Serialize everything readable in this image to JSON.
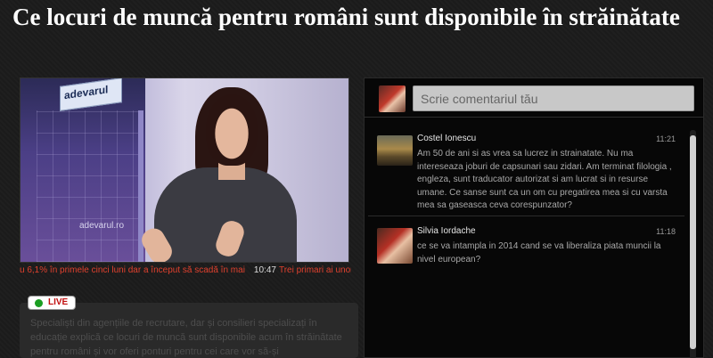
{
  "article": {
    "title": "Ce locuri de muncă pentru români sunt disponibile în străinătate",
    "description": "Specialiști din agențiile de recrutare, dar și consilieri specializați în educație explică ce locuri de muncă sunt disponibile acum în străinătate pentru români și vor oferi ponturi pentru cei care vor să-și îmbunătățească șansele în ochii"
  },
  "video": {
    "logo_top": "adevarul",
    "logo_bottom": "adevarul.ro"
  },
  "ticker": {
    "left": "u 6,1% în primele cinci luni dar a început să scadă în mai",
    "time": "10:47",
    "right": "Trei primari ai unor co"
  },
  "live": {
    "label": "LIVE"
  },
  "comment_box": {
    "placeholder": "Scrie comentariul tău"
  },
  "comments": [
    {
      "author": "Costel Ionescu",
      "time": "11:21",
      "text": "Am 50 de ani si as vrea sa lucrez in strainatate. Nu ma intereseaza joburi de capsunari sau zidari. Am terminat filologia , engleza, sunt traducator autorizat si am lucrat si in resurse umane. Ce sanse sunt ca un om cu pregatirea mea si cu varsta mea sa gaseasca ceva corespunzator?"
    },
    {
      "author": "Silvia Iordache",
      "time": "11:18",
      "text": "ce se va intampla in 2014 cand se va liberaliza piata muncii la nivel european?"
    }
  ],
  "colors": {
    "ticker": "#e0412e",
    "live_dot": "#1b9e22",
    "live_text": "#c21010"
  }
}
